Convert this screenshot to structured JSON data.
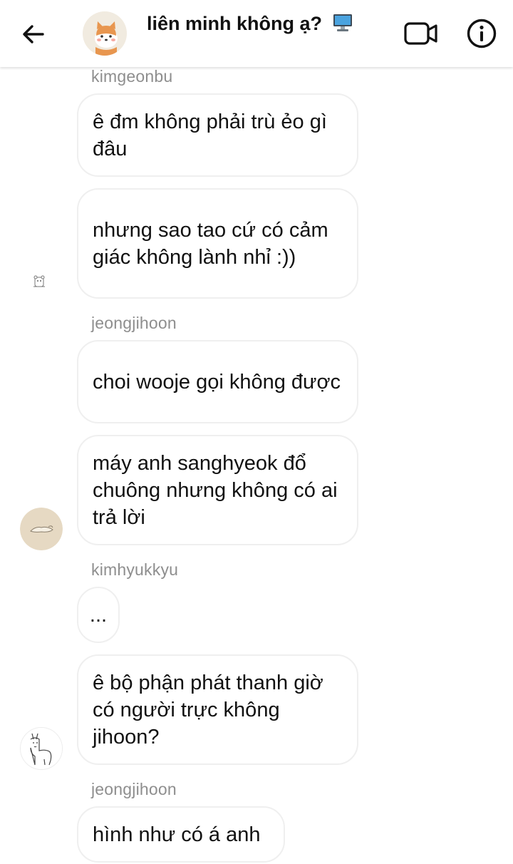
{
  "header": {
    "back_icon": "arrow-left-icon",
    "title": "liên minh không ạ?",
    "title_emoji": "desktop-computer-icon",
    "video_icon": "video-camera-icon",
    "info_icon": "info-icon"
  },
  "messages": [
    {
      "sender": "kimgeonbu",
      "text": "ê đm không phải trù ẻo gì đâu"
    },
    {
      "text": "nhưng sao tao cứ có cảm giác không lành nhỉ :))"
    },
    {
      "sender": "jeongjihoon",
      "text": "choi wooje gọi không được"
    },
    {
      "text": "máy anh sanghyeok đổ chuông nhưng không có ai trả lời"
    },
    {
      "sender": "kimhyukkyu",
      "text": "..."
    },
    {
      "text": "ê bộ phận phát thanh giờ có người trực không jihoon?"
    },
    {
      "sender": "jeongjihoon",
      "text": "hình như có á anh"
    }
  ],
  "colors": {
    "sender_text": "#8e8e8e",
    "bubble_border": "#efefef",
    "background": "#ffffff"
  }
}
